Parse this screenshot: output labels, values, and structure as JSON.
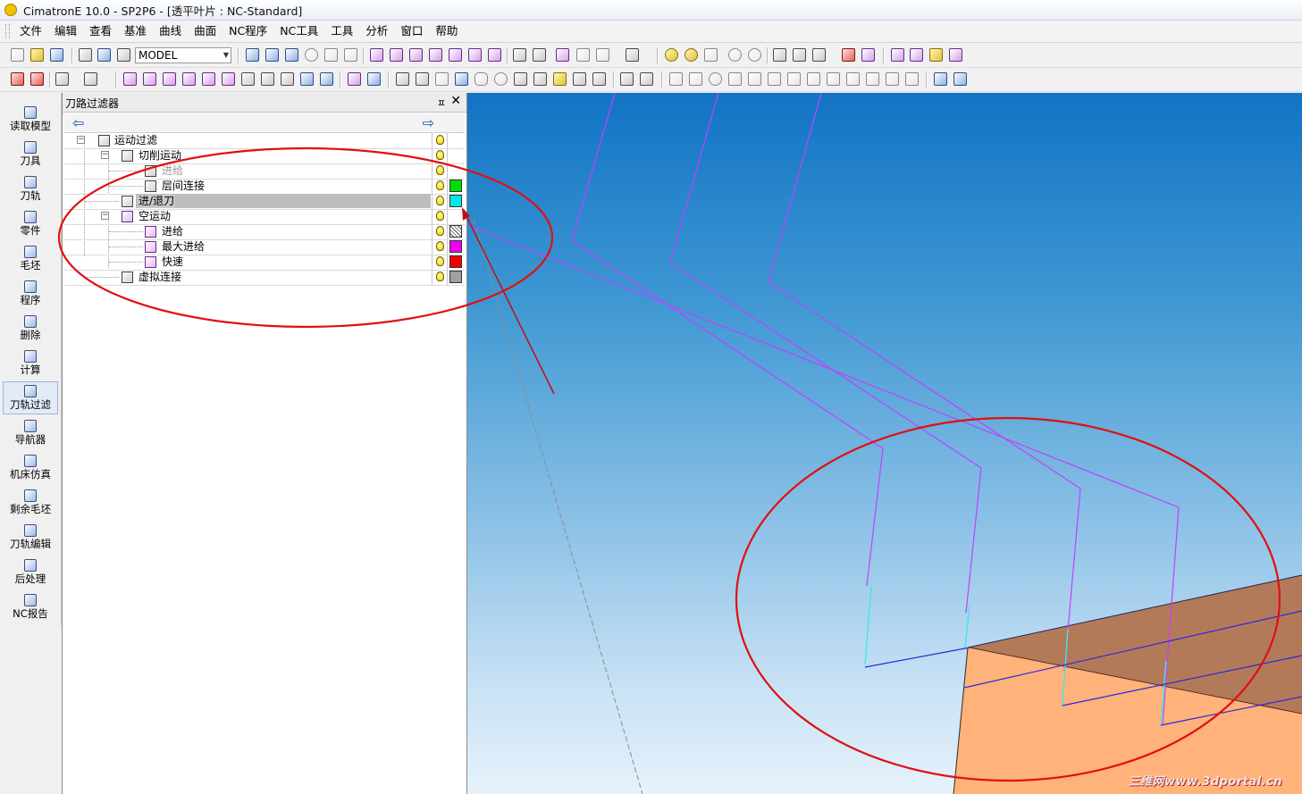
{
  "window": {
    "title": "CimatronE 10.0 - SP2P6 - [透平叶片 : NC-Standard]"
  },
  "menu": [
    "文件",
    "编辑",
    "查看",
    "基准",
    "曲线",
    "曲面",
    "NC程序",
    "NC工具",
    "工具",
    "分析",
    "窗口",
    "帮助"
  ],
  "toolbar": {
    "model_combo": "MODEL"
  },
  "sidebar": {
    "items": [
      {
        "label": "读取模型",
        "icon": "read-model-icon"
      },
      {
        "label": "刀具",
        "icon": "tool-icon"
      },
      {
        "label": "刀轨",
        "icon": "toolpath-icon"
      },
      {
        "label": "零件",
        "icon": "part-icon"
      },
      {
        "label": "毛坯",
        "icon": "stock-icon"
      },
      {
        "label": "程序",
        "icon": "procedure-icon"
      },
      {
        "label": "删除",
        "icon": "delete-icon"
      },
      {
        "label": "计算",
        "icon": "compute-icon"
      },
      {
        "label": "刀轨过滤",
        "icon": "toolpath-filter-icon",
        "active": true
      },
      {
        "label": "导航器",
        "icon": "navigator-icon"
      },
      {
        "label": "机床仿真",
        "icon": "machine-sim-icon"
      },
      {
        "label": "剩余毛坯",
        "icon": "remaining-stock-icon"
      },
      {
        "label": "刀轨编辑",
        "icon": "toolpath-edit-icon"
      },
      {
        "label": "后处理",
        "icon": "post-process-icon"
      },
      {
        "label": "NC报告",
        "icon": "nc-report-icon"
      }
    ]
  },
  "panel": {
    "title": "刀路过滤器",
    "tree": [
      {
        "label": "运动过滤",
        "level": 0,
        "expander": "−",
        "swatch": null
      },
      {
        "label": "切削运动",
        "level": 1,
        "expander": "−",
        "swatch": null
      },
      {
        "label": "进给",
        "level": 2,
        "expander": null,
        "swatch": null,
        "dim": true
      },
      {
        "label": "层间连接",
        "level": 2,
        "expander": null,
        "swatch": "#00e000"
      },
      {
        "label": "进/退刀",
        "level": 1,
        "expander": null,
        "swatch": "#00e8e8",
        "selected": true
      },
      {
        "label": "空运动",
        "level": 1,
        "expander": "−",
        "swatch": null
      },
      {
        "label": "进给",
        "level": 2,
        "expander": null,
        "swatch": "pattern"
      },
      {
        "label": "最大进给",
        "level": 2,
        "expander": null,
        "swatch": "#f000f0"
      },
      {
        "label": "快速",
        "level": 2,
        "expander": null,
        "swatch": "#f00000"
      },
      {
        "label": "虚拟连接",
        "level": 1,
        "expander": null,
        "swatch": "#a0a0a0"
      }
    ]
  },
  "colors": {
    "toolpath": "#c040ff",
    "approach": "#40e8e8",
    "annotation": "#e01010",
    "part": "#ffb27a"
  },
  "watermark": "三维网www.3dportal.cn"
}
